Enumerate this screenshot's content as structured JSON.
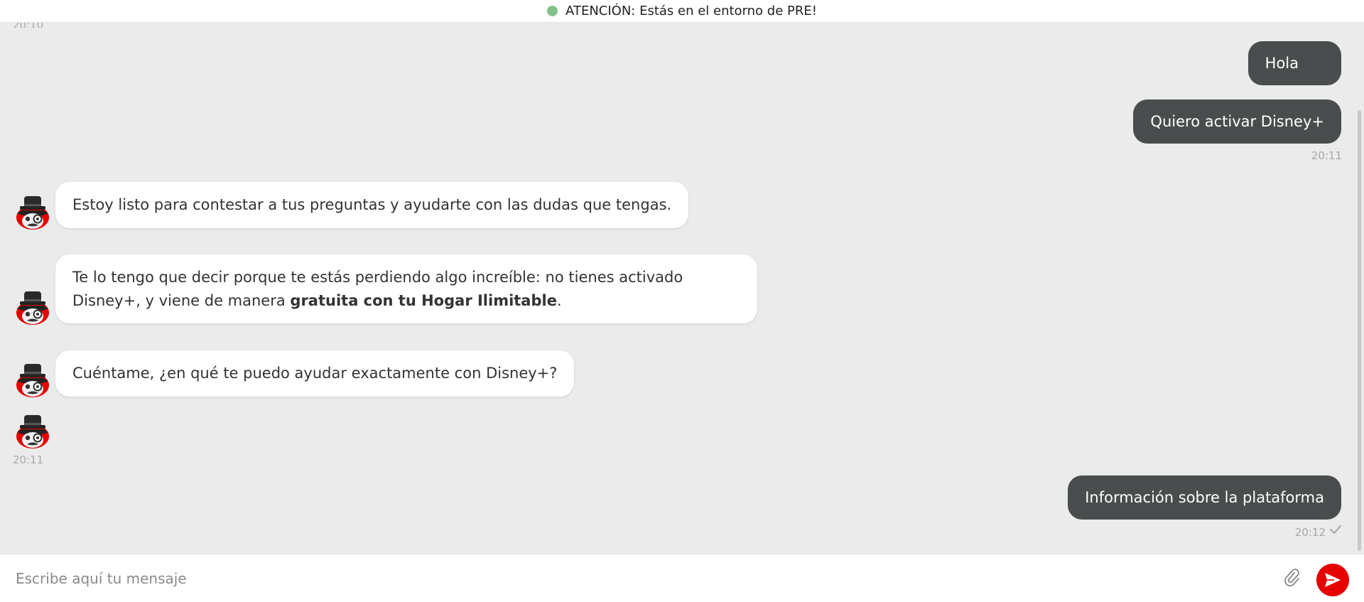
{
  "banner": {
    "text": "ATENCIÓN: Estás en el entorno de PRE!",
    "status_color": "#85c08a"
  },
  "timestamps": {
    "top_cut": "20:10",
    "user_block_1": "20:11",
    "bot_block": "20:11",
    "user_block_2": "20:12"
  },
  "messages": {
    "user_1": "Hola",
    "user_2": "Quiero activar Disney+",
    "bot_1": "Estoy listo para contestar a tus preguntas y ayudarte con las dudas que tengas.",
    "bot_2_part1": "Te lo tengo que decir porque te estás perdiendo algo increíble: no tienes activado Disney+, y viene de manera ",
    "bot_2_bold": "gratuita con tu Hogar Ilimitable",
    "bot_2_part2": ".",
    "bot_3": "Cuéntame, ¿en qué te puedo ayudar exactamente con Disney+?",
    "user_3": "Información sobre la plataforma"
  },
  "composer": {
    "placeholder": "Escribe aquí tu mensaje",
    "value": ""
  },
  "icons": {
    "avatar": "bot-avatar-icon",
    "attach": "paperclip-icon",
    "send": "send-icon",
    "read": "check-icon"
  },
  "colors": {
    "background": "#ebebeb",
    "user_bubble": "#4a4d4e",
    "bot_bubble": "#ffffff",
    "send_button": "#e60000",
    "avatar_accent": "#e60000"
  }
}
